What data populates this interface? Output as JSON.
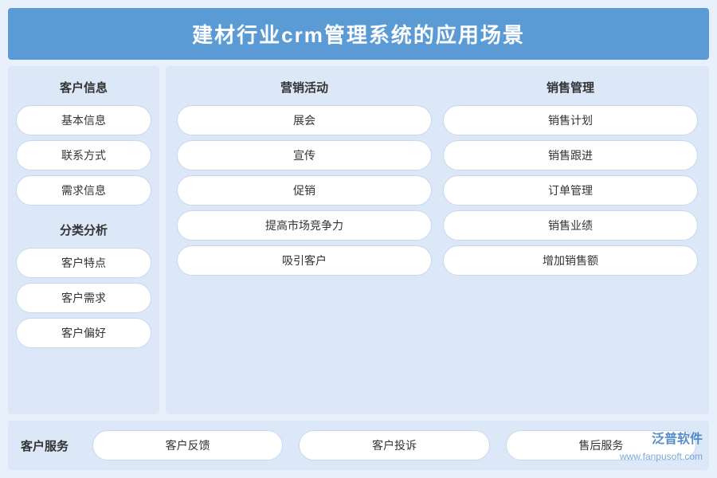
{
  "title": "建材行业crm管理系统的应用场景",
  "left_panel": {
    "section1_header": "客户信息",
    "section1_items": [
      "基本信息",
      "联系方式",
      "需求信息"
    ],
    "section2_header": "分类分析",
    "section2_items": [
      "客户特点",
      "客户需求",
      "客户偏好"
    ]
  },
  "right_panel": {
    "col1_header": "营销活动",
    "col1_items": [
      "展会",
      "宣传",
      "促销",
      "提高市场竞争力",
      "吸引客户"
    ],
    "col2_header": "销售管理",
    "col2_items": [
      "销售计划",
      "销售跟进",
      "订单管理",
      "销售业绩",
      "增加销售额"
    ]
  },
  "bottom_bar": {
    "label": "客户服务",
    "items": [
      "客户反馈",
      "客户投诉",
      "售后服务"
    ]
  },
  "watermark": {
    "logo": "泛普软件",
    "url": "www.fanpusoft.com"
  }
}
